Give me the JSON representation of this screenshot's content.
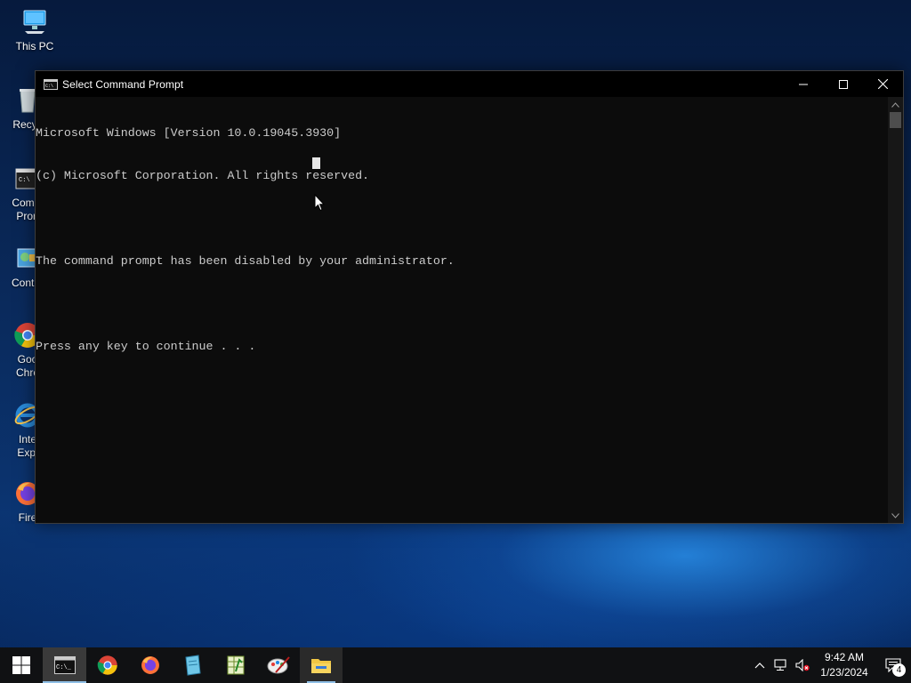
{
  "desktop": {
    "icons": [
      {
        "label": "This PC"
      },
      {
        "label": "Recyc"
      },
      {
        "label": "Comm\nPron"
      },
      {
        "label": "Contro"
      },
      {
        "label": "Goo\nChro"
      },
      {
        "label": "Inte\nExpl"
      },
      {
        "label": "Fire"
      }
    ]
  },
  "window": {
    "title": "Select Command Prompt",
    "console_lines": [
      "Microsoft Windows [Version 10.0.19045.3930]",
      "(c) Microsoft Corporation. All rights reserved.",
      "",
      "The command prompt has been disabled by your administrator.",
      "",
      "Press any key to continue . . ."
    ],
    "controls": {
      "minimize": "minimize-icon",
      "maximize": "maximize-icon",
      "close": "close-icon"
    }
  },
  "taskbar": {
    "apps": [
      "start-icon",
      "command-prompt-icon",
      "chrome-icon",
      "firefox-icon",
      "notepad-icon",
      "spreadsheet-icon",
      "paint-icon",
      "file-explorer-icon"
    ],
    "clock": {
      "time": "9:42 AM",
      "date": "1/23/2024"
    },
    "notification_count": "4"
  },
  "colors": {
    "console_bg": "#0c0c0c",
    "console_text": "#cccccc",
    "titlebar": "#000000",
    "taskbar": "#101113",
    "accent": "#8fbfe6"
  }
}
